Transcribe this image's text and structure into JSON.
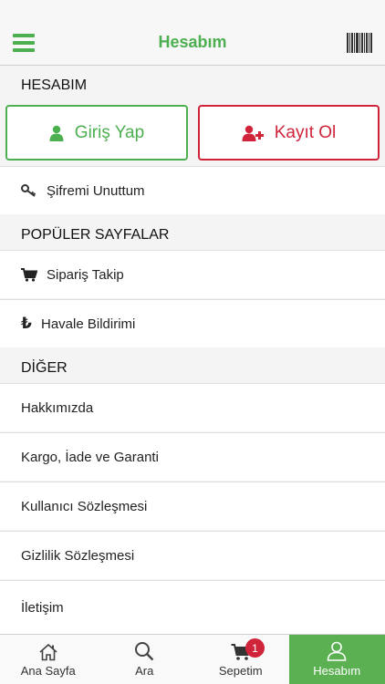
{
  "header": {
    "title": "Hesabım"
  },
  "account": {
    "section_title": "HESABIM",
    "login_label": "Giriş Yap",
    "register_label": "Kayıt Ol",
    "forgot_label": "Şifremi Unuttum"
  },
  "popular": {
    "section_title": "POPÜLER SAYFALAR",
    "order_tracking": "Sipariş Takip",
    "transfer_notice": "Havale Bildirimi",
    "lira_symbol": "₺"
  },
  "other": {
    "section_title": "DİĞER",
    "items": [
      "Hakkımızda",
      "Kargo, İade ve Garanti",
      "Kullanıcı Sözleşmesi",
      "Gizlilik Sözleşmesi",
      "İletişim"
    ]
  },
  "tabbar": {
    "home": "Ana Sayfa",
    "search": "Ara",
    "cart": "Sepetim",
    "cart_count": "1",
    "account": "Hesabım"
  },
  "colors": {
    "accent": "#4caf50",
    "danger": "#d0243b",
    "active_tab": "#5bb152"
  }
}
